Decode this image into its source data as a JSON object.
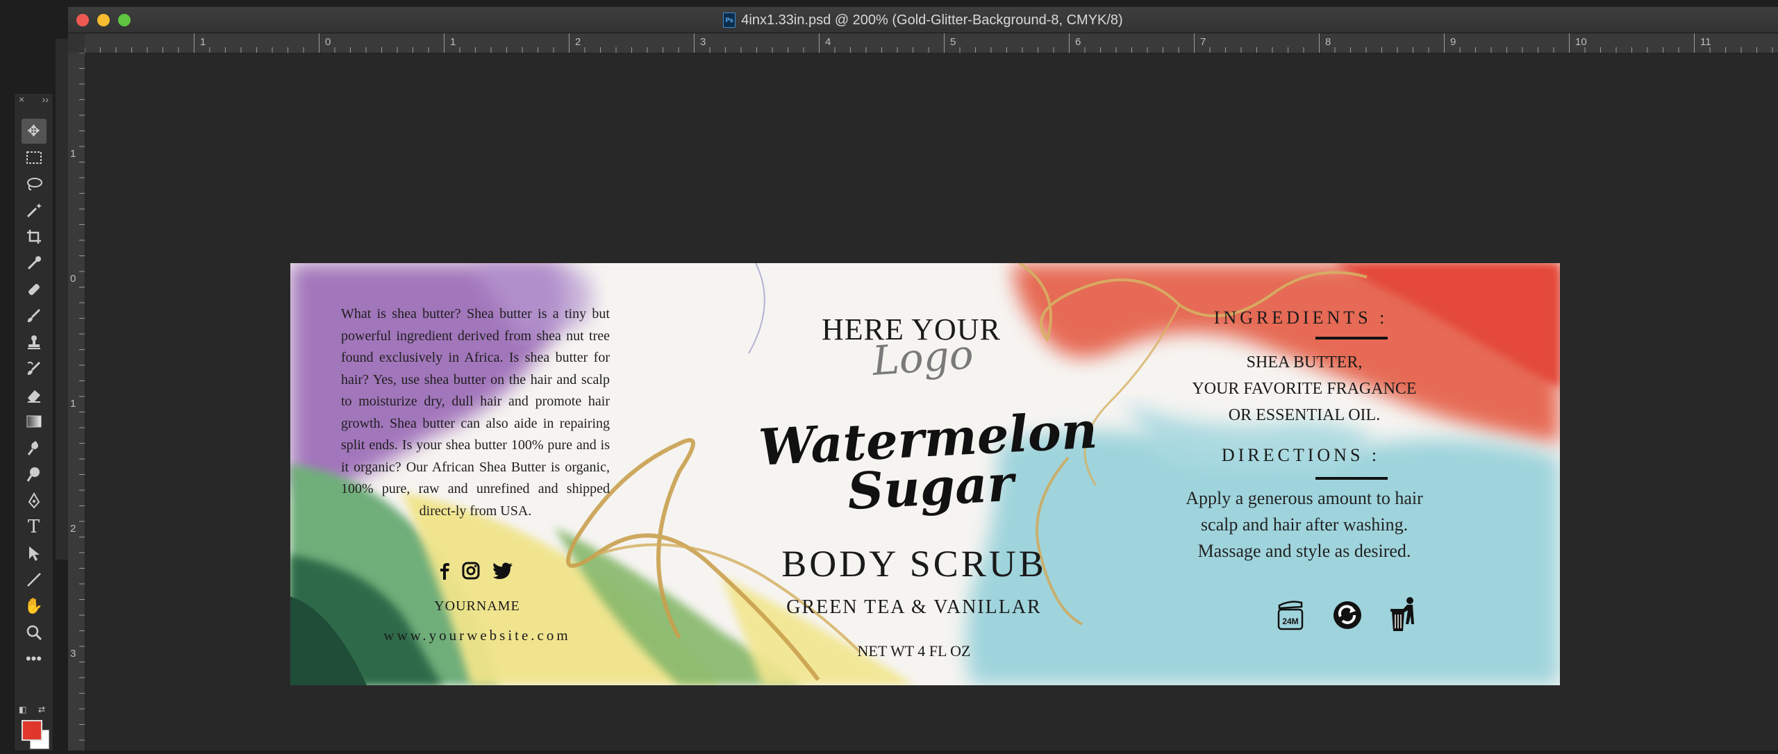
{
  "window": {
    "title": "4inx1.33in.psd @ 200% (Gold-Glitter-Background-8, CMYK/8)"
  },
  "ruler": {
    "top_marks": [
      "1",
      "0",
      "1",
      "2",
      "3",
      "4",
      "5",
      "6",
      "7",
      "8",
      "9",
      "10",
      "11"
    ],
    "left_marks": [
      "1",
      "0",
      "1",
      "2",
      "3"
    ]
  },
  "toolbar": {
    "tools": [
      "move-tool",
      "marquee-tool",
      "lasso-tool",
      "magic-wand-tool",
      "crop-tool",
      "eyedropper-tool",
      "healing-brush-tool",
      "brush-tool",
      "clone-stamp-tool",
      "history-brush-tool",
      "eraser-tool",
      "gradient-tool",
      "blur-tool",
      "dodge-tool",
      "pen-tool",
      "type-tool",
      "path-selection-tool",
      "line-tool",
      "hand-tool",
      "zoom-tool",
      "more-tools"
    ],
    "foreground_color": "#e0362b",
    "background_color": "#ffffff"
  },
  "label": {
    "about_text": "What is shea butter? Shea butter is a tiny but powerful ingredient derived from shea nut tree found exclusively in Africa. Is shea butter for hair? Yes, use shea butter on the hair and scalp to moisturize dry, dull hair and promote hair growth. Shea butter can also aide in repairing split ends. Is your shea butter 100% pure and is it organic? Our African Shea Butter is organic, 100% pure, raw and unrefined and shipped direct-ly from USA.",
    "your_name": "YOURNAME",
    "website": "www.yourwebsite.com",
    "logo_main": "HERE YOUR",
    "logo_script": "Logo",
    "product_line1": "Watermelon",
    "product_line2": "Sugar",
    "product_type": "BODY SCRUB",
    "flavor": "GREEN TEA & VANILLAR",
    "net_weight": "NET WT 4 FL OZ",
    "ingredients_heading": "INGREDIENTS :",
    "ingredients_line1": "SHEA BUTTER,",
    "ingredients_line2": "YOUR FAVORITE FRAGANCE",
    "ingredients_line3": "OR ESSENTIAL OIL.",
    "directions_heading": "DIRECTIONS :",
    "directions_line1": "Apply a generous amount to hair",
    "directions_line2": "scalp and hair after washing.",
    "directions_line3": "Massage and style as desired.",
    "pao_label": "24M",
    "icons": [
      "facebook-icon",
      "instagram-icon",
      "twitter-icon",
      "pao-24m-icon",
      "recycle-icon",
      "trash-bin-icon"
    ]
  }
}
